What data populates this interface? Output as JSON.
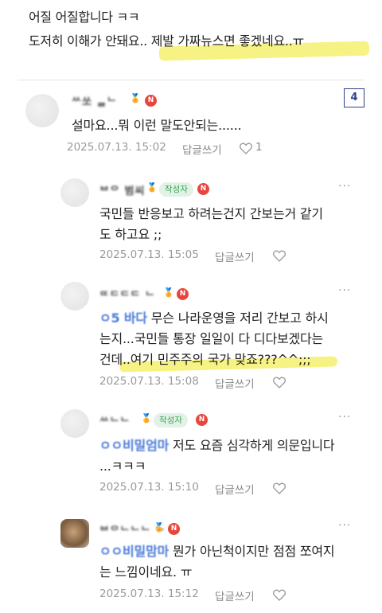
{
  "post_tail": {
    "line1": "어질 어질합니다 ㅋㅋ",
    "line2": "도저히 이해가 안돼요.. 제발 가짜뉴스면 좋겠네요..ㅠ"
  },
  "page_indicator": "4",
  "more_label": "···",
  "comments": [
    {
      "nickname": "ᄊ쏘 ᆯᄂ",
      "medal": "🏅",
      "n_badge": "N",
      "author_badge": "",
      "mention": "",
      "text_lines": [
        "설마요...뭐 이런 말도안되는......"
      ],
      "date": "2025.07.13. 15:02",
      "reply_label": "답글쓰기",
      "likes": "1"
    },
    {
      "nickname": "ᄇᄋ 범씨",
      "medal": "🏅",
      "n_badge": "N",
      "author_badge": "작성자",
      "mention": "",
      "text_lines": [
        "국민들 반응보고 하려는건지 간보는거 같기",
        "도 하고요 ;;"
      ],
      "date": "2025.07.13. 15:05",
      "reply_label": "답글쓰기",
      "likes": ""
    },
    {
      "nickname": "ᄄᄃᄃᄃ ᄂ",
      "medal": "🏅",
      "n_badge": "N",
      "author_badge": "",
      "mention": "ㅇ5 바다",
      "text_lines": [
        "무슨 나라운영을 저리 간보고 하시",
        "는지...국민들 통장 일일이 다 디다보겠다는",
        "건데..여기 민주주의 국가 맞죠???^^;;;"
      ],
      "date": "2025.07.13. 15:08",
      "reply_label": "답글쓰기",
      "likes": ""
    },
    {
      "nickname": "ᄊᄂᄂ",
      "medal": "🏅",
      "n_badge": "N",
      "author_badge": "작성자",
      "mention": "ㅇㅇ비밀엄마",
      "text_lines": [
        "저도 요즘 심각하게 의문입니다",
        "...ㅋㅋㅋ"
      ],
      "date": "2025.07.13. 15:10",
      "reply_label": "답글쓰기",
      "likes": ""
    },
    {
      "nickname": "ᄇᄋᄂᄂᄂ ᄂ",
      "medal": "🏅",
      "n_badge": "N",
      "author_badge": "",
      "mention": "ㅇㅇ비밀맘마",
      "text_lines": [
        "뭔가 아닌척이지만 점점 쪼여지",
        "는 느낌이네요. ㅠ"
      ],
      "date": "2025.07.13. 15:12",
      "reply_label": "답글쓰기",
      "likes": ""
    }
  ]
}
